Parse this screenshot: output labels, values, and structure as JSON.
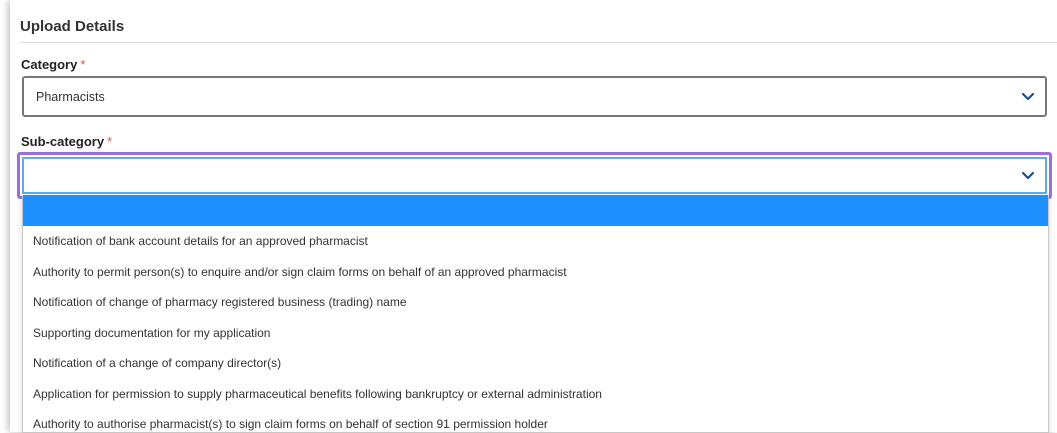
{
  "section": {
    "title": "Upload Details"
  },
  "category": {
    "label": "Category",
    "required_mark": "*",
    "value": "Pharmacists"
  },
  "subcategory": {
    "label": "Sub-category",
    "required_mark": "*",
    "value": "",
    "options": [
      "",
      "Notification of bank account details for an approved pharmacist",
      "Authority to permit person(s) to enquire and/or sign claim forms on behalf of an approved pharmacist",
      "Notification of change of pharmacy registered business (trading) name",
      "Supporting documentation for my application",
      "Notification of a change of company director(s)",
      "Application for permission to supply pharmaceutical benefits following bankruptcy or external administration",
      "Authority to authorise pharmacist(s) to sign claim forms on behalf of section 91 permission holder"
    ]
  },
  "colors": {
    "highlight": "#1e90ff",
    "focus_ring": "#9b6ee0",
    "chevron": "#1a4f8a",
    "required": "#d9534f"
  },
  "icons": {
    "dropdown": "chevron-down-icon"
  }
}
